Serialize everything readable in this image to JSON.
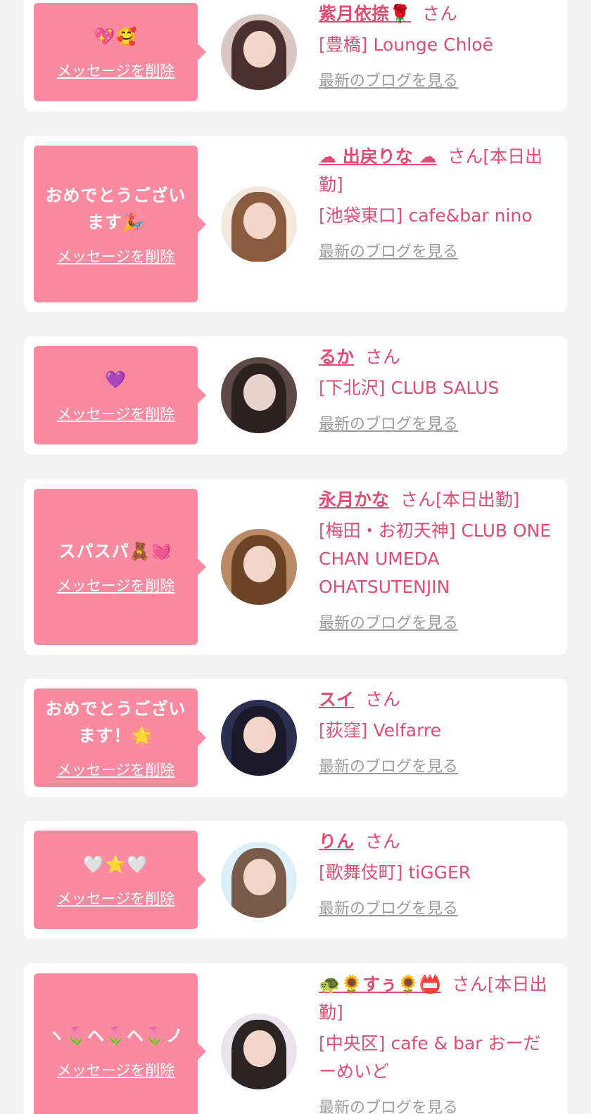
{
  "delete_label": "メッセージを削除",
  "blog_label": "最新のブログを見る",
  "items": [
    {
      "message": "💖🥰",
      "name": "紫月依捺🌹",
      "honorific": "さん",
      "shop": "[豊橋] Lounge Chloē"
    },
    {
      "message": "おめでとうございます🎉",
      "name": "☁ 出戻りな ☁",
      "honorific": "さん[本日出勤]",
      "shop": "[池袋東口] cafe&bar nino"
    },
    {
      "message": "💜",
      "name": "るか",
      "honorific": "さん",
      "shop": "[下北沢] CLUB SALUS"
    },
    {
      "message": "スパスパ🧸💓",
      "name": "永月かな",
      "honorific": "さん[本日出勤]",
      "shop": "[梅田・お初天神] CLUB ONE CHAN UMEDA OHATSUTENJIN"
    },
    {
      "message": "おめでとうございます！🌟",
      "name": "スイ",
      "honorific": "さん",
      "shop": "[荻窪] Velfarre"
    },
    {
      "message": "🤍⭐🤍",
      "name": "りん",
      "honorific": "さん",
      "shop": "[歌舞伎町] tiGGER"
    },
    {
      "message": "ヽ🌷ヘ🌷ヘ🌷ノ",
      "name": "🐢🌻すぅ🌻📛",
      "honorific": "さん[本日出勤]",
      "shop": "[中央区] cafe & bar おーだーめいど"
    }
  ],
  "colors": {
    "bubble": "#fa8aa0",
    "accent": "#e24b72",
    "link_gray": "#9b9b9b",
    "background": "#f2f2f2"
  }
}
